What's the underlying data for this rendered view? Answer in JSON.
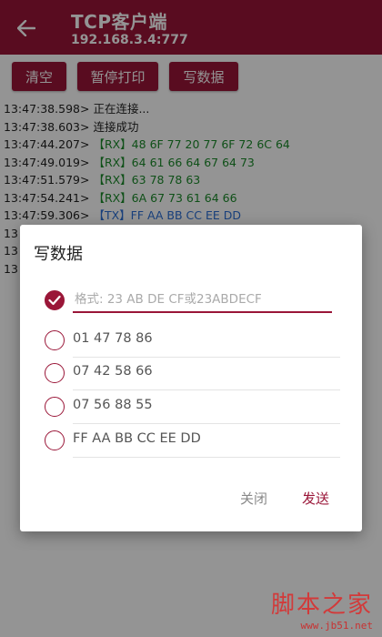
{
  "appbar": {
    "title": "TCP客户端",
    "subtitle": "192.168.3.4:777",
    "back_icon": "arrow-left-icon"
  },
  "toolbar": {
    "clear_label": "清空",
    "pause_label": "暂停打印",
    "write_label": "写数据"
  },
  "log": [
    {
      "ts": "13:47:38.598>",
      "msg": "正在连接...",
      "kind": "plain"
    },
    {
      "ts": "13:47:38.603>",
      "msg": "连接成功",
      "kind": "plain"
    },
    {
      "ts": "13:47:44.207>",
      "msg": "【RX】48 6F 77 20 77 6F 72 6C 64",
      "kind": "rx"
    },
    {
      "ts": "13:47:49.019>",
      "msg": "【RX】64 61 66 64 67 64 73",
      "kind": "rx"
    },
    {
      "ts": "13:47:51.579>",
      "msg": "【RX】63 78 78 63",
      "kind": "rx"
    },
    {
      "ts": "13:47:54.241>",
      "msg": "【RX】6A 67 73 61 64 66",
      "kind": "rx"
    },
    {
      "ts": "13:47:59.306>",
      "msg": "【TX】FF AA BB CC EE DD",
      "kind": "tx"
    },
    {
      "ts": "13",
      "msg": "",
      "kind": "plain"
    },
    {
      "ts": "13",
      "msg": "",
      "kind": "plain"
    },
    {
      "ts": "13",
      "msg": "",
      "kind": "plain"
    }
  ],
  "dialog": {
    "title": "写数据",
    "input_placeholder": "格式: 23 AB DE CF或23ABDECF",
    "input_value": "",
    "options": [
      "01 47 78 86",
      "07 42 58 66",
      "07 56 88 55",
      "FF AA BB CC EE DD"
    ],
    "close_label": "关闭",
    "send_label": "发送"
  },
  "watermark": {
    "big": "脚本之家",
    "small": "www.jb51.net"
  },
  "colors": {
    "primary": "#9a1638",
    "rx": "#1a8a2a",
    "tx": "#2b6fd6"
  }
}
